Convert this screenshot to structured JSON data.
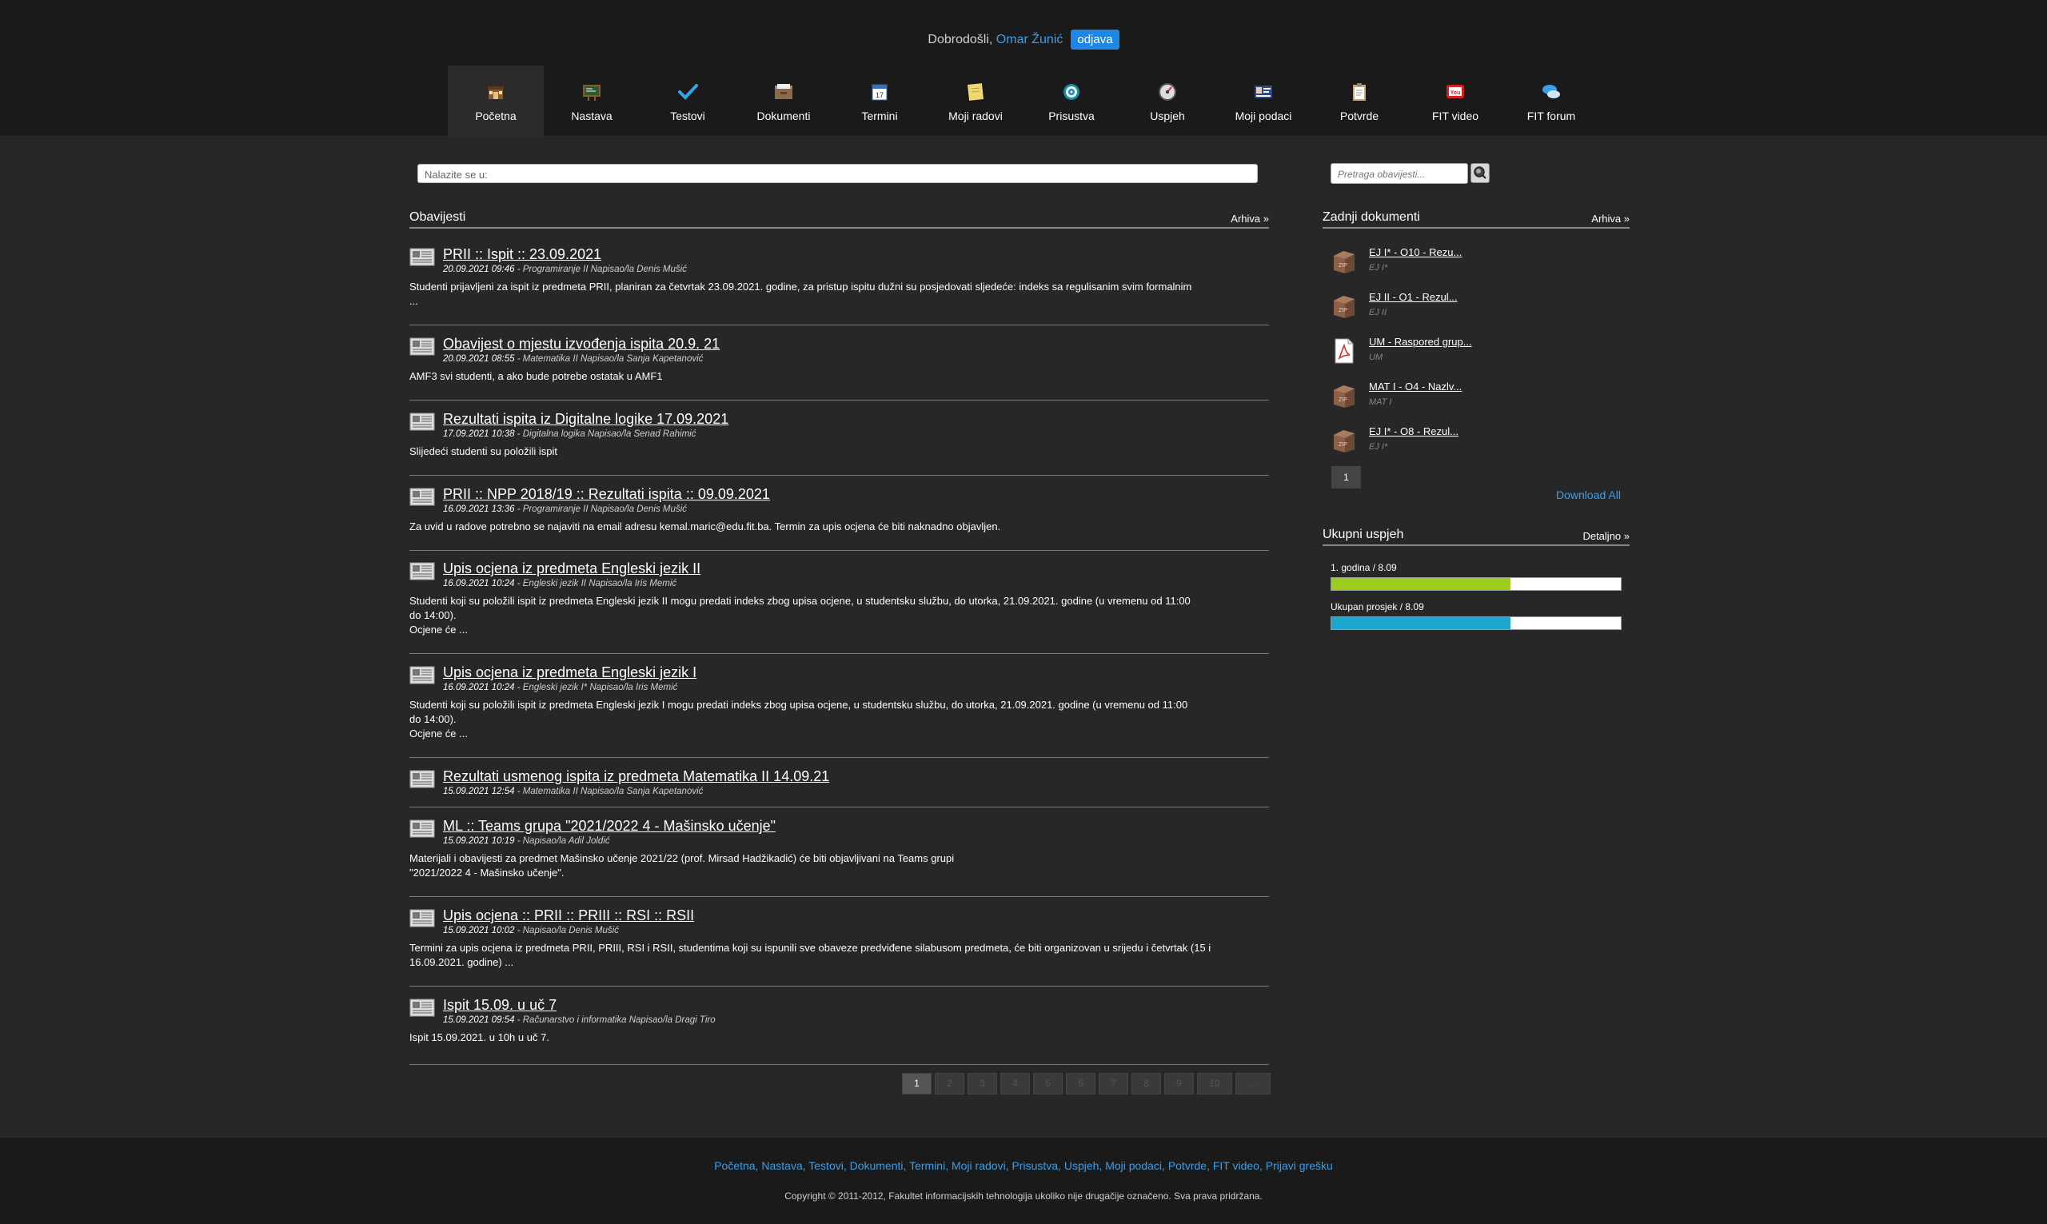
{
  "header": {
    "welcome_text": "Dobrodošli, ",
    "user_name": "Omar Žunić",
    "logout_label": "odjava"
  },
  "nav": [
    {
      "label": "Početna",
      "icon": "home-icon",
      "active": true
    },
    {
      "label": "Nastava",
      "icon": "blackboard-icon"
    },
    {
      "label": "Testovi",
      "icon": "checkmark-icon"
    },
    {
      "label": "Dokumenti",
      "icon": "documents-box-icon"
    },
    {
      "label": "Termini",
      "icon": "calendar-icon"
    },
    {
      "label": "Moji radovi",
      "icon": "notepad-icon"
    },
    {
      "label": "Prisustva",
      "icon": "target-icon"
    },
    {
      "label": "Uspjeh",
      "icon": "gauge-icon"
    },
    {
      "label": "Moji podaci",
      "icon": "id-card-icon"
    },
    {
      "label": "Potvrde",
      "icon": "clipboard-icon"
    },
    {
      "label": "FIT video",
      "icon": "youtube-icon"
    },
    {
      "label": "FIT forum",
      "icon": "chat-bubbles-icon"
    }
  ],
  "breadcrumb": "Nalazite se u:",
  "news_section": {
    "title": "Obavijesti",
    "archive_label": "Arhiva »"
  },
  "news": [
    {
      "title": "PRII :: Ispit :: 23.09.2021",
      "date": "20.09.2021 09:46",
      "meta": " - Programiranje II Napisao/la Denis Mušić",
      "body": "Studenti prijavljeni za ispit iz predmeta PRII, planiran za četvrtak 23.09.2021. godine, za pristup ispitu dužni su posjedovati sljedeće: indeks sa regulisanim svim formalnim\n..."
    },
    {
      "title": "Obavijest o mjestu izvođenja ispita 20.9. 21",
      "date": "20.09.2021 08:55",
      "meta": " - Matematika II Napisao/la Sanja Kapetanović",
      "body": "AMF3 svi studenti, a ako bude potrebe ostatak u AMF1"
    },
    {
      "title": "Rezultati ispita iz Digitalne logike 17.09.2021",
      "date": "17.09.2021 10:38",
      "meta": " - Digitalna logika Napisao/la Senad Rahimić",
      "body": "Slijedeći studenti su položili ispit"
    },
    {
      "title": "PRII :: NPP 2018/19 :: Rezultati ispita :: 09.09.2021",
      "date": "16.09.2021 13:36",
      "meta": " - Programiranje II Napisao/la Denis Mušić",
      "body": "Za uvid u radove potrebno se najaviti na email adresu kemal.maric@edu.fit.ba. Termin za upis ocjena će biti naknadno objavljen."
    },
    {
      "title": "Upis ocjena iz predmeta Engleski jezik II",
      "date": "16.09.2021 10:24",
      "meta": " - Engleski jezik II Napisao/la Iris Memić",
      "body": "Studenti koji su položili ispit iz predmeta Engleski jezik II mogu predati indeks zbog upisa ocjene, u studentsku službu, do utorka, 21.09.2021. godine (u vremenu od 11:00\ndo 14:00).\nOcjene će ..."
    },
    {
      "title": "Upis ocjena iz predmeta Engleski jezik I",
      "date": "16.09.2021 10:24",
      "meta": " - Engleski jezik I* Napisao/la Iris Memić",
      "body": "Studenti koji su položili ispit iz predmeta Engleski jezik I mogu predati indeks zbog upisa ocjene, u studentsku službu, do utorka, 21.09.2021. godine (u vremenu od 11:00\ndo 14:00).\nOcjene će ..."
    },
    {
      "title": "Rezultati usmenog ispita iz predmeta Matematika II 14.09.21",
      "date": "15.09.2021 12:54",
      "meta": " - Matematika II Napisao/la Sanja Kapetanović",
      "body": ""
    },
    {
      "title": "ML :: Teams grupa \"2021/2022 4 - Mašinsko učenje\"",
      "date": "15.09.2021 10:19",
      "meta": " - Napisao/la Adil Joldić",
      "body": "Materijali i obavijesti za predmet Mašinsko učenje 2021/22 (prof. Mirsad Hadžikadić) će biti objavljivani na Teams grupi\n\"2021/2022 4 - Mašinsko učenje\"."
    },
    {
      "title": "Upis ocjena :: PRII :: PRIII :: RSI :: RSII",
      "date": "15.09.2021 10:02",
      "meta": " - Napisao/la Denis Mušić",
      "body": "Termini za upis ocjena iz predmeta PRII, PRIII, RSI i RSII, studentima koji su ispunili sve obaveze predviđene silabusom predmeta, će biti organizovan u srijedu i četvrtak (15 i\n16.09.2021. godine) ..."
    },
    {
      "title": "Ispit 15.09. u uč 7",
      "date": "15.09.2021 09:54",
      "meta": " - Računarstvo i informatika Napisao/la Dragi Tiro",
      "body": "Ispit 15.09.2021. u 10h u uč 7."
    }
  ],
  "pager": [
    "1",
    "2",
    "3",
    "4",
    "5",
    "6",
    "7",
    "8",
    "9",
    "10",
    "..."
  ],
  "search": {
    "placeholder": "Pretraga obavijesti..."
  },
  "docs_section": {
    "title": "Zadnji dokumenti",
    "archive_label": "Arhiva »"
  },
  "docs": [
    {
      "title": "EJ I* - O10 - Rezu...",
      "subject": "EJ I*",
      "icon": "archive-box-icon"
    },
    {
      "title": "EJ II - O1 - Rezul...",
      "subject": "EJ II",
      "icon": "archive-box-icon"
    },
    {
      "title": "UM - Raspored grup...",
      "subject": "UM",
      "icon": "pdf-icon"
    },
    {
      "title": "MAT I - O4 - Nazlv...",
      "subject": "MAT I",
      "icon": "archive-box-icon"
    },
    {
      "title": "EJ I* - O8 - Rezul...",
      "subject": "EJ I*",
      "icon": "archive-box-icon"
    }
  ],
  "docs_page": "1",
  "download_all": "Download All",
  "success_section": {
    "title": "Ukupni uspjeh",
    "detail_label": "Detaljno »"
  },
  "success": [
    {
      "label": "1. godina / 8.09",
      "fraction": 0.62,
      "color": "#9ccc1e"
    },
    {
      "label": "Ukupan prosjek / 8.09",
      "fraction": 0.62,
      "color": "#1fa6cf"
    }
  ],
  "footer": {
    "links": [
      "Početna",
      "Nastava",
      "Testovi",
      "Dokumenti",
      "Termini",
      "Moji radovi",
      "Prisustva",
      "Uspjeh",
      "Moji podaci",
      "Potvrde",
      "FIT video",
      "Prijavi grešku"
    ],
    "copyright": "Copyright © 2011-2012, Fakultet informacijskih tehnologija ukoliko nije drugačije označeno. Sva prava pridržana."
  }
}
